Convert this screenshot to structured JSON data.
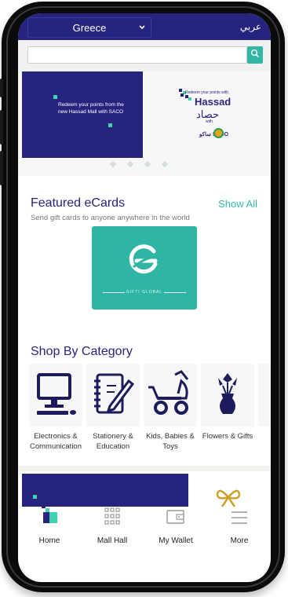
{
  "topbar": {
    "country": "Greece",
    "language_link": "عربي"
  },
  "search": {
    "placeholder": ""
  },
  "banner": {
    "text": "Redeem your points from the new Hassad Mall with SACO",
    "logo_tagline": "Redeem your points with",
    "logo_name": "Hassad",
    "logo_arabic": "حصاد",
    "logo_with": "with",
    "logo_partner": "ساكو SACO",
    "slide_count": 4
  },
  "featured": {
    "title": "Featured eCards",
    "show_all": "Show All",
    "subtitle": "Send gift cards to anyone anywhere in the world",
    "card_brand": "GIFTI GLOBAL",
    "card_color": "#2fb5a4"
  },
  "shop": {
    "title": "Shop By Category",
    "categories": [
      {
        "label": "Electronics & Communication",
        "icon": "computer-icon"
      },
      {
        "label": "Stationery & Education",
        "icon": "notebook-pencil-icon"
      },
      {
        "label": "Kids, Babies & Toys",
        "icon": "stroller-icon"
      },
      {
        "label": "Flowers & Gifts",
        "icon": "flower-vase-icon"
      }
    ]
  },
  "tabbar": {
    "items": [
      {
        "label": "Home",
        "icon": "home-logo-icon"
      },
      {
        "label": "Mall Hall",
        "icon": "grid-icon"
      },
      {
        "label": "My Wallet",
        "icon": "wallet-icon"
      },
      {
        "label": "More",
        "icon": "menu-icon"
      }
    ]
  },
  "colors": {
    "brand": "#27247f",
    "accent": "#2fbfa8"
  }
}
